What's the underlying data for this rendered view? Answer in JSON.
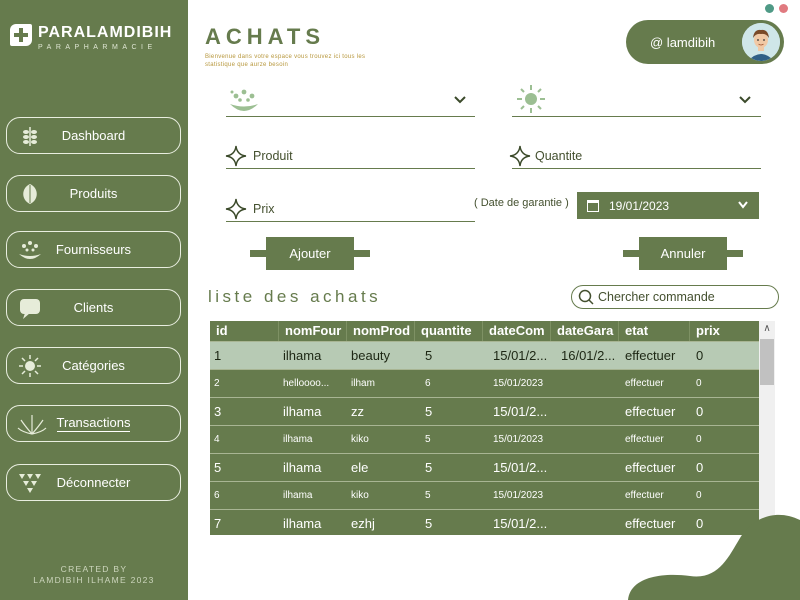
{
  "brand": {
    "name": "PARALAMDIBIH",
    "tagline": "PARAPHARMACIE"
  },
  "sidebar": {
    "items": [
      {
        "label": "Dashboard",
        "icon": "leaf-sprig-icon"
      },
      {
        "label": "Produits",
        "icon": "leaf-icon"
      },
      {
        "label": "Fournisseurs",
        "icon": "drops-icon"
      },
      {
        "label": "Clients",
        "icon": "chat-bubble-icon"
      },
      {
        "label": "Catégories",
        "icon": "sun-icon"
      },
      {
        "label": "Transactions",
        "icon": "plant-icon"
      },
      {
        "label": "Déconnecter",
        "icon": "triangles-icon"
      }
    ],
    "active": "Transactions"
  },
  "credit": {
    "line1": "CREATED BY",
    "line2": "LAMDIBIH ILHAME 2023"
  },
  "header": {
    "title": "ACHATS",
    "subtitle": "Bienvenue dans votre espace vous trouvez ici tous les statistique que aurze besoin"
  },
  "user": {
    "name": "@ lamdibih"
  },
  "form": {
    "produit_label": "Produit",
    "quantite_label": "Quantite",
    "prix_label": "Prix",
    "garantie_label": "( Date de garantie )",
    "date_value": "19/01/2023",
    "ajouter_label": "Ajouter",
    "annuler_label": "Annuler"
  },
  "list": {
    "title": "liste des achats",
    "search_placeholder": "Chercher commande"
  },
  "table": {
    "columns": [
      "id",
      "nomFour",
      "nomProd",
      "quantite",
      "dateCom",
      "dateGara",
      "etat",
      "prix"
    ],
    "rows": [
      {
        "id": "1",
        "nomFour": "ilhama",
        "nomProd": "beauty",
        "quantite": "5",
        "dateCom": "15/01/2...",
        "dateGara": "16/01/2...",
        "etat": "effectuer",
        "prix": "0"
      },
      {
        "id": "2",
        "nomFour": "helloooo...",
        "nomProd": "ilham",
        "quantite": "6",
        "dateCom": "15/01/2023",
        "dateGara": "",
        "etat": "effectuer",
        "prix": "0"
      },
      {
        "id": "3",
        "nomFour": "ilhama",
        "nomProd": "zz",
        "quantite": "5",
        "dateCom": "15/01/2...",
        "dateGara": "",
        "etat": "effectuer",
        "prix": "0"
      },
      {
        "id": "4",
        "nomFour": "ilhama",
        "nomProd": "kiko",
        "quantite": "5",
        "dateCom": "15/01/2023",
        "dateGara": "",
        "etat": "effectuer",
        "prix": "0"
      },
      {
        "id": "5",
        "nomFour": "ilhama",
        "nomProd": "ele",
        "quantite": "5",
        "dateCom": "15/01/2...",
        "dateGara": "",
        "etat": "effectuer",
        "prix": "0"
      },
      {
        "id": "6",
        "nomFour": "ilhama",
        "nomProd": "kiko",
        "quantite": "5",
        "dateCom": "15/01/2023",
        "dateGara": "",
        "etat": "effectuer",
        "prix": "0"
      },
      {
        "id": "7",
        "nomFour": "ilhama",
        "nomProd": "ezhj",
        "quantite": "5",
        "dateCom": "15/01/2...",
        "dateGara": "",
        "etat": "effectuer",
        "prix": "0"
      }
    ],
    "selected_row": 0
  },
  "colors": {
    "primary": "#667b4d",
    "selected_row": "#b7cab4",
    "accent_text": "#b7973c",
    "dot_green": "#4f9a86",
    "dot_red": "#e07a80"
  }
}
